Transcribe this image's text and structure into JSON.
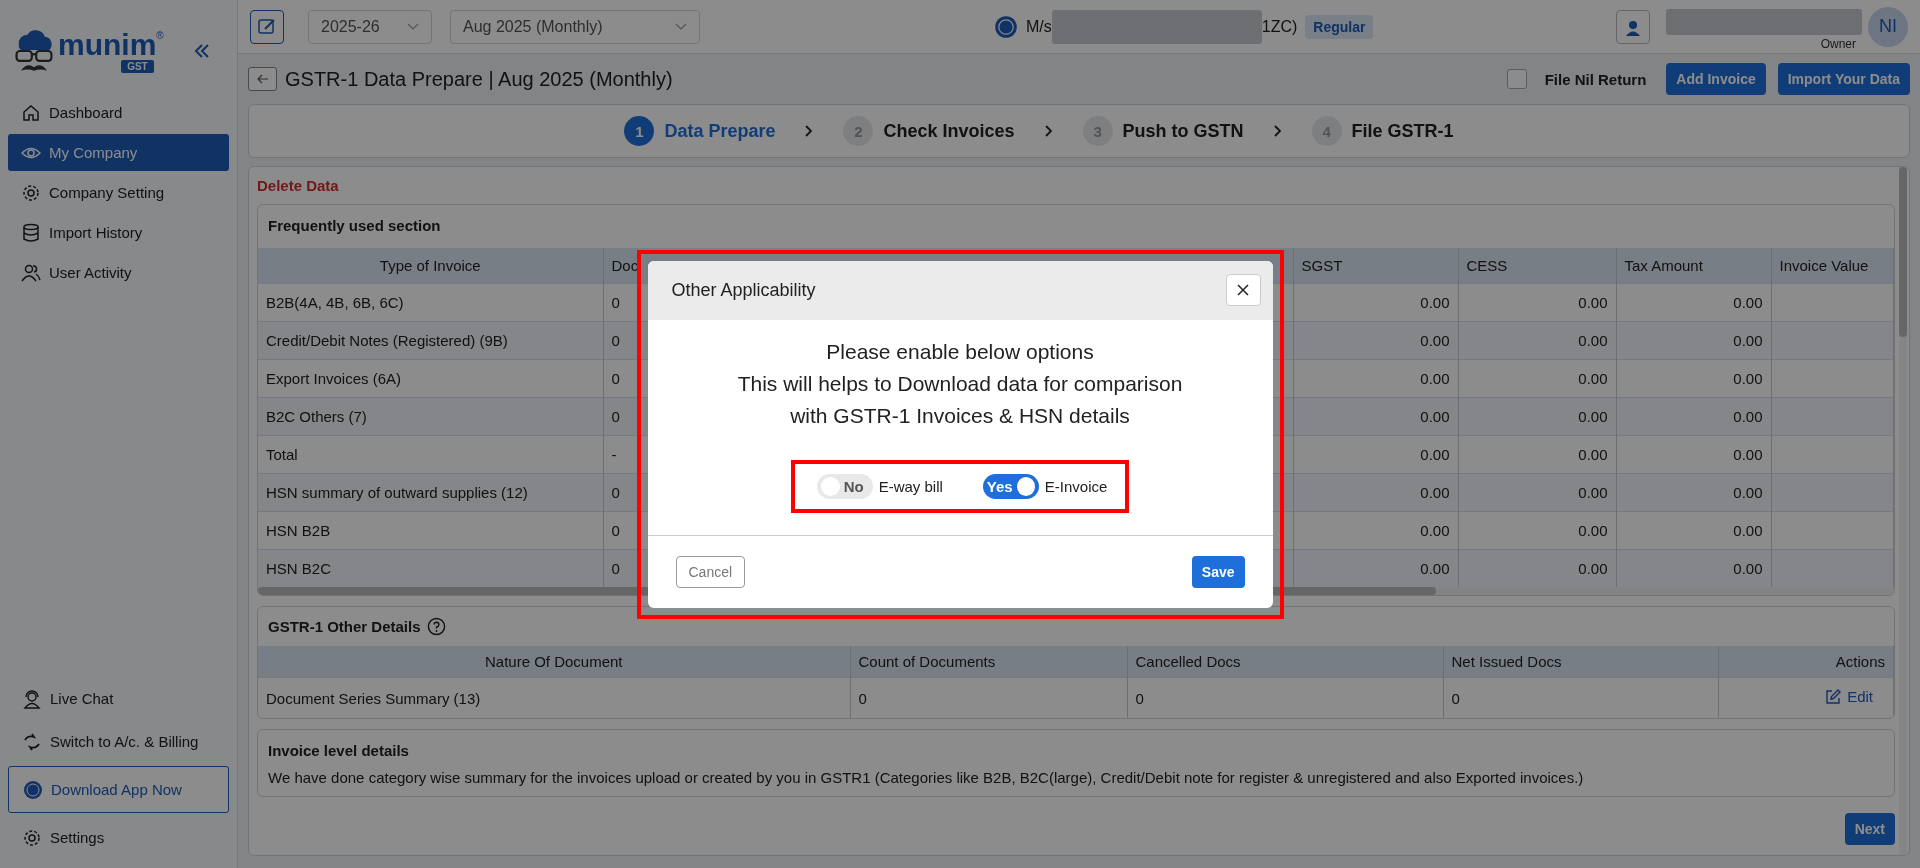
{
  "sidebar": {
    "brand": "munim",
    "brand_mark": "®",
    "brand_badge": "GST",
    "items": [
      {
        "label": "Dashboard",
        "selected": false
      },
      {
        "label": "My Company",
        "selected": true
      },
      {
        "label": "Company Setting",
        "selected": false
      },
      {
        "label": "Import History",
        "selected": false
      },
      {
        "label": "User Activity",
        "selected": false
      }
    ],
    "live_chat": "Live Chat",
    "switch": "Switch to A/c. & Billing",
    "download": "Download App Now",
    "settings": "Settings"
  },
  "topbar": {
    "year": "2025-26",
    "period": "Aug 2025 (Monthly)",
    "company_prefix": "M/s",
    "company_suffix": "1ZC)",
    "company_type": "Regular",
    "user_role": "Owner",
    "avatar_initials": "NI"
  },
  "page": {
    "title": "GSTR-1 Data Prepare | Aug 2025 (Monthly)",
    "nil_return": {
      "label": "File Nil Return",
      "checked": false
    },
    "buttons": [
      "Add Invoice",
      "Import Your Data"
    ]
  },
  "steps": [
    {
      "number": "1",
      "label": "Data Prepare",
      "selected": true
    },
    {
      "number": "2",
      "label": "Check Invoices",
      "selected": false
    },
    {
      "number": "3",
      "label": "Push to GSTN",
      "selected": false
    },
    {
      "number": "4",
      "label": "File GSTR-1",
      "selected": false
    }
  ],
  "delete_data": "Delete Data",
  "frequent": {
    "title": "Frequently used section",
    "columns": [
      "Type of Invoice",
      "Doc",
      "SGST",
      "CESS",
      "Tax Amount",
      "Invoice Value"
    ],
    "rows": [
      [
        "B2B(4A, 4B, 6B, 6C)",
        "0",
        "0.00",
        "0.00",
        "0.00"
      ],
      [
        "Credit/Debit Notes (Registered) (9B)",
        "0",
        "0.00",
        "0.00",
        "0.00"
      ],
      [
        "Export Invoices (6A)",
        "0",
        "0.00",
        "0.00",
        "0.00"
      ],
      [
        "B2C Others (7)",
        "0",
        "0.00",
        "0.00",
        "0.00"
      ],
      [
        "Total",
        "-",
        "0.00",
        "0.00",
        "0.00"
      ],
      [
        "HSN summary of outward supplies (12)",
        "0",
        "0.00",
        "0.00",
        "0.00"
      ],
      [
        "HSN B2B",
        "0",
        "0.00",
        "0.00",
        "0.00"
      ],
      [
        "HSN B2C",
        "0",
        "0.00",
        "0.00",
        "0.00"
      ]
    ]
  },
  "other_details": {
    "title": "GSTR-1 Other Details",
    "columns": [
      "Nature Of Document",
      "Count of Documents",
      "Cancelled Docs",
      "Net Issued Docs",
      "Actions"
    ],
    "rows": [
      {
        "cells": [
          "Document Series Summary (13)",
          "0",
          "0",
          "0"
        ],
        "action": "Edit"
      }
    ]
  },
  "invoice_level": {
    "title": "Invoice level details",
    "text": "We have done category wise summary for the invoices upload or created by you in GSTR1 (Categories like B2B, B2C(large), Credit/Debit note for register & unregistered and also Exported invoices.)"
  },
  "next": "Next",
  "modal": {
    "title": "Other Applicability",
    "lines": [
      "Please enable below options",
      "This will helps to Download data for comparison",
      "with GSTR-1 Invoices & HSN details"
    ],
    "toggles": [
      {
        "state_label": "No",
        "label": "E-way bill",
        "on": false
      },
      {
        "state_label": "Yes",
        "label": "E-Invoice",
        "on": true
      }
    ],
    "cancel": "Cancel",
    "save": "Save"
  }
}
